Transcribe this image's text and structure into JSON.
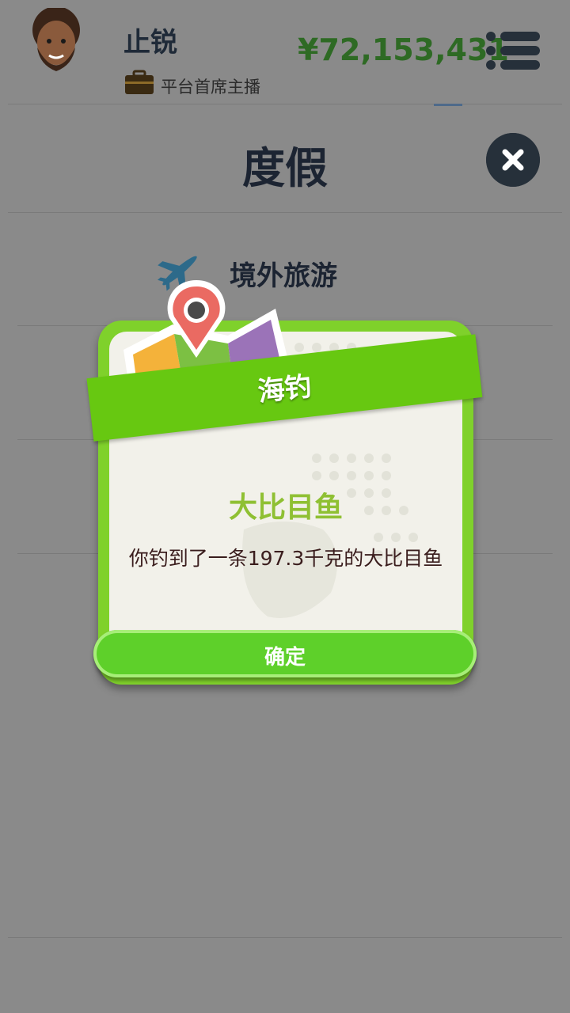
{
  "header": {
    "username": "止锐",
    "role": "平台首席主播",
    "money": "¥72,153,431",
    "icons": {
      "avatar": "avatar-bearded-man",
      "role": "briefcase-icon",
      "menu": "menu-icon"
    }
  },
  "page": {
    "title": "度假",
    "close_icon": "close-icon"
  },
  "list": {
    "items": [
      {
        "label": "境外旅游",
        "icon": "airplane-icon"
      }
    ]
  },
  "dialog": {
    "ribbon": "海钓",
    "fish_name": "大比目鱼",
    "message": "你钓到了一条197.3千克的大比目鱼",
    "confirm_label": "确定",
    "icon": "map-pin-icon"
  },
  "colors": {
    "overlay": "#8a8a8a",
    "money": "#2e6a24",
    "dialog_frame": "#7fd12b",
    "ribbon": "#67c811",
    "fish_title": "#8fc033",
    "button": "#5ed02a"
  }
}
